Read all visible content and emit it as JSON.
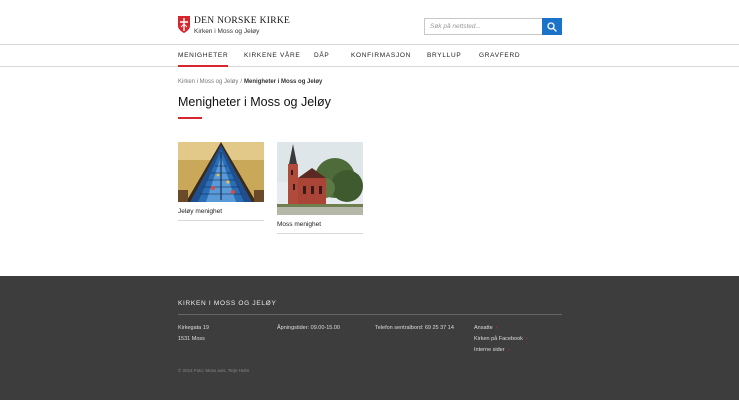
{
  "header": {
    "logo_title": "DEN NORSKE KIRKE",
    "logo_subtitle": "Kirken i Moss og Jeløy",
    "search_placeholder": "Søk på nettsted...",
    "accent_color": "#d8262f",
    "search_button_color": "#1a73c8"
  },
  "nav": {
    "items": [
      {
        "label": "MENIGHETER",
        "active": true
      },
      {
        "label": "KIRKENE VÅRE",
        "active": false
      },
      {
        "label": "DÅP",
        "active": false
      },
      {
        "label": "KONFIRMASJON",
        "active": false
      },
      {
        "label": "BRYLLUP",
        "active": false
      },
      {
        "label": "GRAVFERD",
        "active": false
      }
    ]
  },
  "breadcrumb": {
    "parent": "Kirken i Moss og Jeløy",
    "separator": "/",
    "current": "Menigheter i Moss og Jeløy"
  },
  "page": {
    "title": "Menigheter i Moss og Jeløy"
  },
  "cards": [
    {
      "label": "Jeløy menighet",
      "image": "church-interior-stained-glass"
    },
    {
      "label": "Moss menighet",
      "image": "red-brick-church-exterior"
    }
  ],
  "footer": {
    "title": "KIRKEN I MOSS OG JELØY",
    "address_line1": "Kirkegata 19",
    "address_line2": "1531 Moss",
    "opening_hours": "Åpningstider: 09.00-15.00",
    "phone": "Telefon sentralbord: 69 25 37 14",
    "links": [
      {
        "label": "Ansatte"
      },
      {
        "label": "Kirken på Facebook"
      },
      {
        "label": "Interne sider"
      }
    ],
    "copyright": "© 2014 Foto: Moss avis, Terje Holm",
    "background_color": "#3d3d3d"
  }
}
